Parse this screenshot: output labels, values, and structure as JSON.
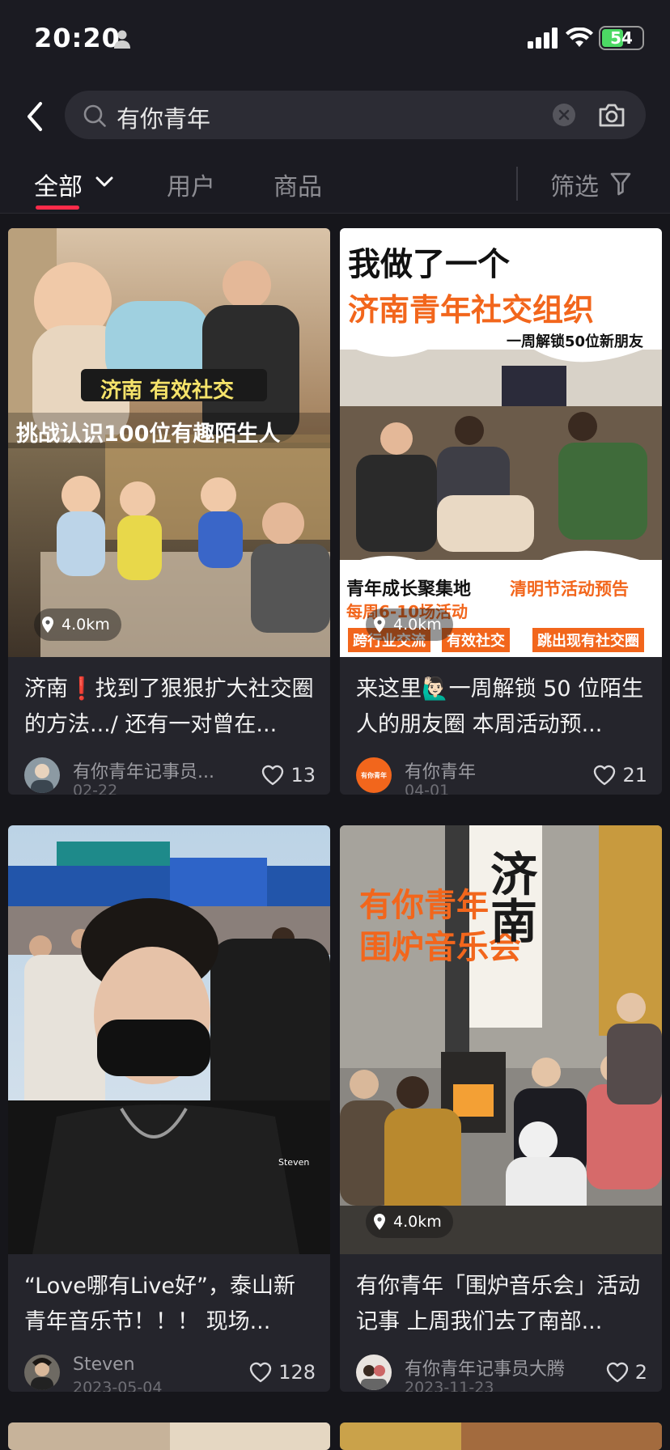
{
  "status_bar": {
    "time": "20:20",
    "battery": "54"
  },
  "search": {
    "query": "有你青年"
  },
  "tabs": {
    "all": "全部",
    "users": "用户",
    "goods": "商品",
    "filter": "筛选"
  },
  "cards": [
    {
      "image_text_1": "济南 有效社交",
      "image_text_2": "挑战认识100位有趣陌生人",
      "distance": "4.0km",
      "title": "济南❗️找到了狠狠扩大社交圈的方法.../ 还有一对曾在...",
      "author": "有你青年记事员...",
      "date": "02-22",
      "likes": "13"
    },
    {
      "image_text_1": "我做了一个",
      "image_text_2": "济南青年社交组织",
      "image_text_3": "一周解锁50位新朋友",
      "image_text_4": "青年成长聚集地",
      "image_text_5": "每周6-10场活动",
      "image_text_6": "清明节活动预告",
      "image_text_7": "跨行业交流",
      "image_text_8": "有效社交",
      "image_text_9": "跳出现有社交圈",
      "distance": "4.0km",
      "title": "来这里🙋🏻‍♂️一周解锁 50 位陌生人的朋友圈 本周活动预...",
      "author": "有你青年",
      "avatar_text": "有你青年",
      "date": "04-01",
      "likes": "21"
    },
    {
      "image_text_1": "Steven",
      "title": "“Love哪有Live好”，泰山新青年音乐节！！！ 现场...",
      "author": "Steven",
      "date": "2023-05-04",
      "likes": "128"
    },
    {
      "image_text_1": "有你青年",
      "image_text_2": "围炉音乐会",
      "image_text_3": "济南",
      "distance": "4.0km",
      "title": "有你青年「围炉音乐会」活动记事 上周我们去了南部...",
      "author": "有你青年记事员大腾",
      "date": "2023-11-23",
      "likes": "2"
    }
  ],
  "colors": {
    "accent": "#ff2b4a",
    "background": "#16161b",
    "card": "#25252c",
    "orange_text": "#f2661c"
  }
}
